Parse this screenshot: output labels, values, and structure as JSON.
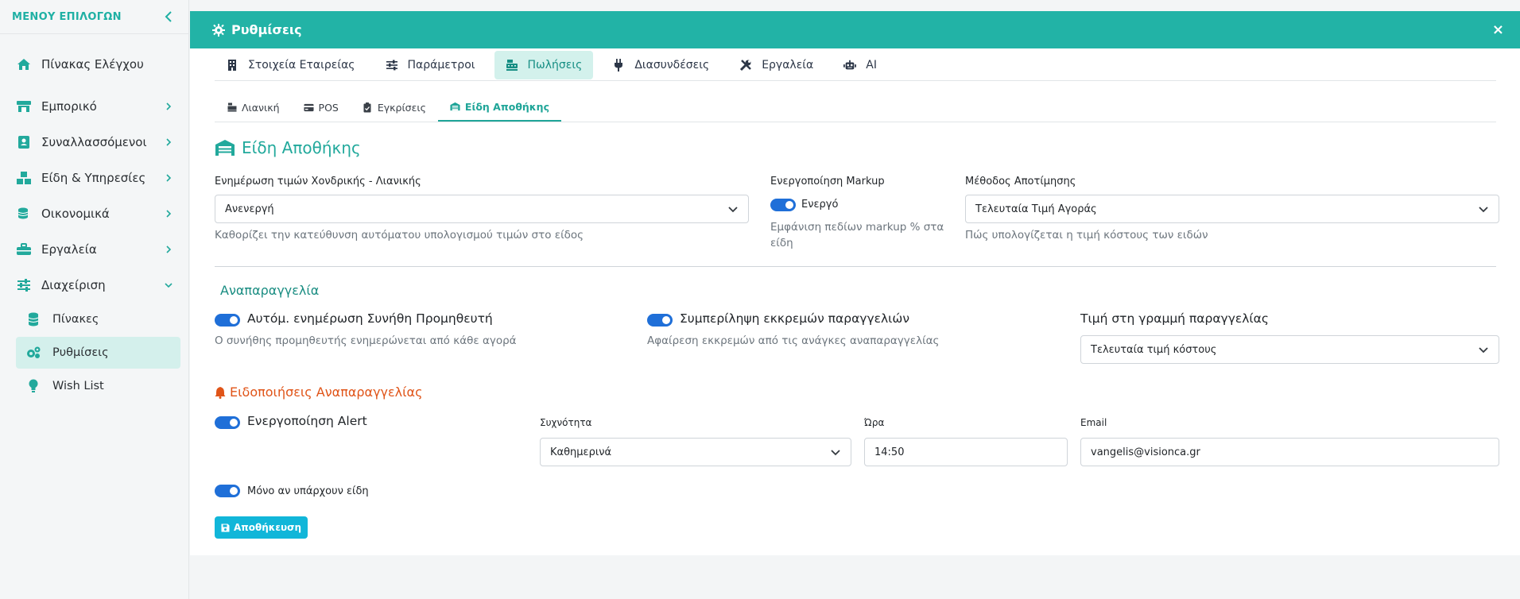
{
  "sidebar": {
    "title": "ΜΕΝΟΥ ΕΠΙΛΟΓΩΝ",
    "items": [
      {
        "label": "Πίνακας Ελέγχου",
        "icon": "home-icon"
      },
      {
        "label": "Εμπορικό",
        "icon": "store-icon"
      },
      {
        "label": "Συναλλασσόμενοι",
        "icon": "contacts-icon"
      },
      {
        "label": "Είδη & Υπηρεσίες",
        "icon": "boxes-icon"
      },
      {
        "label": "Οικονομικά",
        "icon": "coins-icon"
      },
      {
        "label": "Εργαλεία",
        "icon": "toolbox-icon"
      },
      {
        "label": "Διαχείριση",
        "icon": "sliders-icon"
      }
    ],
    "subitems": [
      {
        "label": "Πίνακες",
        "icon": "database-icon"
      },
      {
        "label": "Ρυθμίσεις",
        "icon": "cogs-icon",
        "active": true
      },
      {
        "label": "Wish List",
        "icon": "lightbulb-icon"
      }
    ]
  },
  "panel": {
    "title": "Ρυθμίσεις",
    "close": "×"
  },
  "main_tabs": [
    {
      "label": "Στοιχεία Εταιρείας",
      "icon": "building-icon"
    },
    {
      "label": "Παράμετροι",
      "icon": "sliders-icon"
    },
    {
      "label": "Πωλήσεις",
      "icon": "cash-register-icon",
      "active": true
    },
    {
      "label": "Διασυνδέσεις",
      "icon": "plug-icon"
    },
    {
      "label": "Εργαλεία",
      "icon": "tools-icon"
    },
    {
      "label": "AI",
      "icon": "robot-icon"
    }
  ],
  "sub_tabs": [
    {
      "label": "Λιανική",
      "icon": "cash-register-icon"
    },
    {
      "label": "POS",
      "icon": "credit-card-icon"
    },
    {
      "label": "Εγκρίσεις",
      "icon": "clipboard-check-icon"
    },
    {
      "label": "Είδη Αποθήκης",
      "icon": "warehouse-icon",
      "active": true
    }
  ],
  "section": {
    "title": "Είδη Αποθήκης",
    "price_update": {
      "label": "Ενημέρωση τιμών Χονδρικής - Λιανικής",
      "value": "Ανενεργή",
      "help": "Καθορίζει την κατεύθυνση αυτόματου υπολογισμού τιμών στο είδος"
    },
    "markup": {
      "label": "Ενεργοποίηση Markup",
      "toggle_label": "Ενεργό",
      "help": "Εμφάνιση πεδίων markup % στα είδη"
    },
    "valuation": {
      "label": "Μέθοδος Αποτίμησης",
      "value": "Τελευταία Τιμή Αγοράς",
      "help": "Πώς υπολογίζεται η τιμή κόστους των ειδών"
    }
  },
  "reorder": {
    "title": "Αναπαραγγελία",
    "auto_supplier": {
      "label": "Αυτόμ. ενημέρωση Συνήθη Προμηθευτή",
      "help": "Ο συνήθης προμηθευτής ενημερώνεται από κάθε αγορά"
    },
    "pending": {
      "label": "Συμπερίληψη εκκρεμών παραγγελιών",
      "help": "Αφαίρεση εκκρεμών από τις ανάγκες αναπαραγγελίας"
    },
    "line_price": {
      "label": "Τιμή στη γραμμή παραγγελίας",
      "value": "Τελευταία τιμή κόστους"
    }
  },
  "alerts": {
    "title": "Ειδοποιήσεις Αναπαραγγελίας",
    "enable_label": "Ενεργοποίηση Alert",
    "frequency_label": "Συχνότητα",
    "frequency_value": "Καθημερινά",
    "time_label": "Ώρα",
    "time_value": "14:50",
    "email_label": "Email",
    "email_value": "vangelis@visionca.gr",
    "only_if_label": "Μόνο αν υπάρχουν είδη"
  },
  "save_label": "Αποθήκευση",
  "colors": {
    "accent": "#22b3a6",
    "toggle": "#1f6fd8",
    "alert": "#e05418",
    "save_button": "#11b6d9"
  }
}
